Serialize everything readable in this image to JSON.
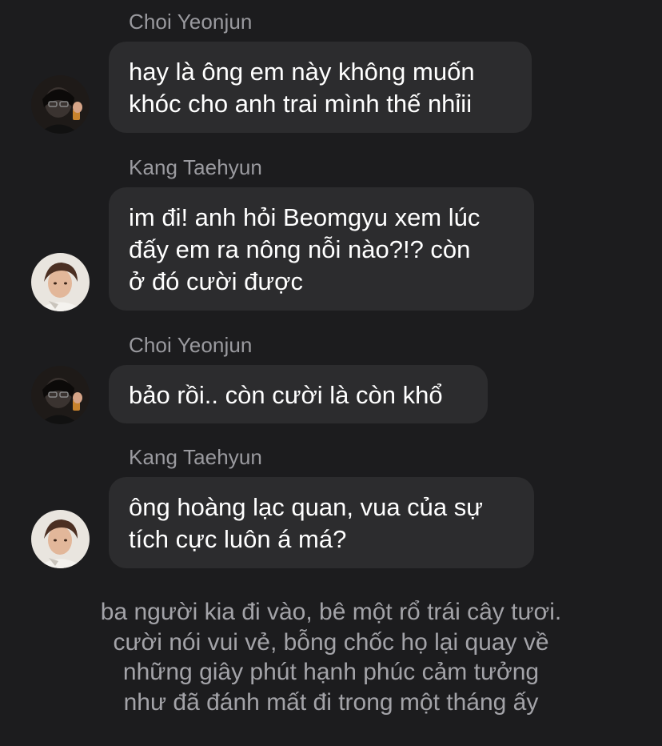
{
  "messages": [
    {
      "sender": "Choi Yeonjun",
      "avatar_icon": "user-photo-icon",
      "lines": [
        "hay là ông em này không muốn",
        "khóc cho anh trai mình thế nhỉii"
      ]
    },
    {
      "sender": "Kang Taehyun",
      "avatar_icon": "user-photo-icon",
      "lines": [
        "im đi! anh hỏi Beomgyu xem lúc",
        "đấy em ra nông nỗi nào?!? còn",
        "ở đó cười được"
      ]
    },
    {
      "sender": "Choi Yeonjun",
      "avatar_icon": "user-photo-icon",
      "lines": [
        "bảo rồi.. còn cười là còn khổ"
      ]
    },
    {
      "sender": "Kang Taehyun",
      "avatar_icon": "user-photo-icon",
      "lines": [
        "ông hoàng lạc quan, vua của sự",
        "tích cực luôn á má?"
      ]
    }
  ],
  "narration": {
    "lines": [
      "ba người kia đi vào, bê một rổ trái cây tươi.",
      "cười nói vui vẻ, bỗng chốc họ lại quay về",
      "những giây phút hạnh phúc cảm tưởng",
      "như đã đánh mất đi trong một tháng ấy"
    ]
  },
  "colors": {
    "background": "#1c1c1e",
    "bubble": "#2c2c2e",
    "sender_text": "#9a9a9f",
    "message_text": "#ffffff",
    "narration_text": "#a3a3a8"
  }
}
